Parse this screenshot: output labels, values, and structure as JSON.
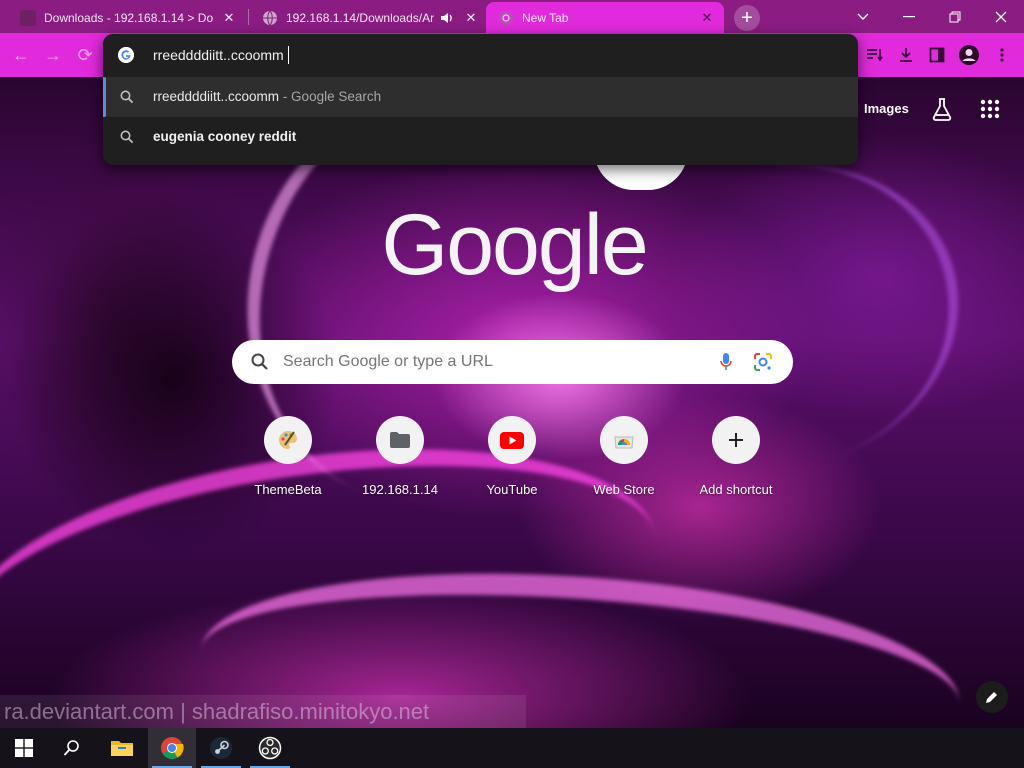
{
  "tabs": [
    {
      "title": "Downloads - 192.168.1.14 > Do",
      "active": false
    },
    {
      "title": "192.168.1.14/Downloads/Ar",
      "active": false,
      "audio": true
    },
    {
      "title": "New Tab",
      "active": true
    }
  ],
  "omnibox": {
    "input_value": "rreeddddiitt..ccoomm",
    "suggestions": [
      {
        "query": "rreeddddiitt..ccoomm",
        "suffix": " - Google Search"
      },
      {
        "query": "eugenia cooney reddit",
        "suffix": ""
      }
    ]
  },
  "ntp": {
    "images_label": "Images",
    "logo_text": "Google",
    "search_placeholder": "Search Google or type a URL",
    "shortcuts": [
      {
        "label": "ThemeBeta",
        "icon": "palette-icon"
      },
      {
        "label": "192.168.1.14",
        "icon": "folder-icon"
      },
      {
        "label": "YouTube",
        "icon": "youtube-icon"
      },
      {
        "label": "Web Store",
        "icon": "chrome-web-store-icon"
      },
      {
        "label": "Add shortcut",
        "icon": "plus-icon"
      }
    ]
  },
  "wallpaper_watermark": "ra.deviantart.com | shadrafiso.minitokyo.net",
  "colors": {
    "tab_strip": "#8b1c82",
    "toolbar": "#e12adb",
    "omnibox_bg": "#1f1f1f",
    "suggestion_highlight": "#2e2e2e",
    "accent_blue": "#5a8de8"
  }
}
